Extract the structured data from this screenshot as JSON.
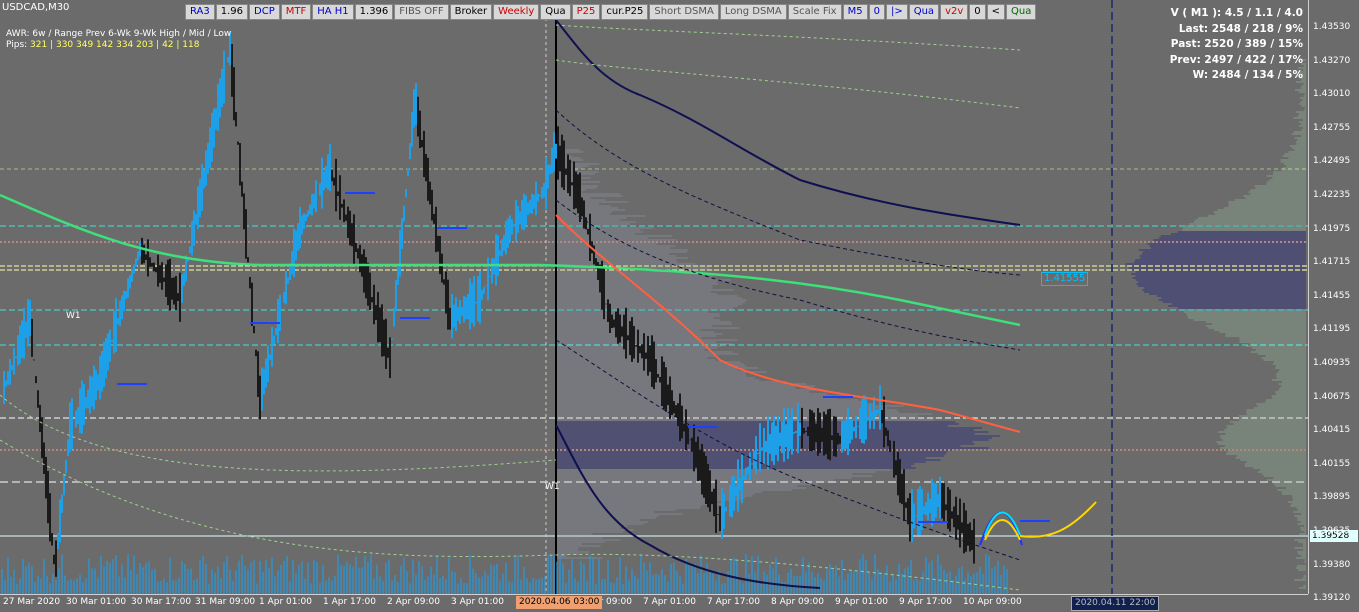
{
  "symbol_label": "USDCAD,M30",
  "toolbar": [
    {
      "label": "RA3",
      "color": "#0000cc"
    },
    {
      "label": "1.96",
      "color": "#000000"
    },
    {
      "label": "DCP",
      "color": "#0000cc"
    },
    {
      "label": "MTF",
      "color": "#cc0000"
    },
    {
      "label": "HA H1",
      "color": "#0000cc"
    },
    {
      "label": "1.396",
      "color": "#000000"
    },
    {
      "label": "FIBS OFF",
      "color": "#555555"
    },
    {
      "label": "Broker",
      "color": "#000000"
    },
    {
      "label": "Weekly",
      "color": "#cc0000"
    },
    {
      "label": "Qua",
      "color": "#000000"
    },
    {
      "label": "P25",
      "color": "#cc0000"
    },
    {
      "label": "cur.P25",
      "color": "#000000"
    },
    {
      "label": "Short DSMA",
      "color": "#555555"
    },
    {
      "label": "Long DSMA",
      "color": "#555555"
    },
    {
      "label": "Scale Fix",
      "color": "#555555"
    },
    {
      "label": "M5",
      "color": "#0000cc"
    },
    {
      "label": "0",
      "color": "#0000cc"
    },
    {
      "label": "|>",
      "color": "#0000cc"
    },
    {
      "label": "Qua",
      "color": "#0000cc"
    },
    {
      "label": "v2v",
      "color": "#cc0000"
    },
    {
      "label": "0",
      "color": "#000000"
    },
    {
      "label": "<",
      "color": "#000000"
    },
    {
      "label": "Qua",
      "color": "#006600"
    }
  ],
  "awr": {
    "line1": "AWR: 6w / Range    Prev      6-Wk       9-Wk       High / Mid / Low",
    "line2_label": "Pips:",
    "line2_values": "321 | 330     349      142       334          203  |  42  |  118"
  },
  "stats": {
    "v_line": "V ( M1 ): 4.5 / 1.1 / 4.0",
    "last": "Last: 2548 / 218 / 9%",
    "past": "Past: 2520 / 389 / 15%",
    "prev": "Prev: 2497 / 422 / 17%",
    "w": "W: 2484 / 134 / 5%"
  },
  "level_label": "1.41555",
  "w1_labels": [
    "W1",
    "W1"
  ],
  "price_axis": [
    "1.43530",
    "1.43270",
    "1.43010",
    "1.42755",
    "1.42495",
    "1.42235",
    "1.41975",
    "1.41715",
    "1.41455",
    "1.41195",
    "1.40935",
    "1.40675",
    "1.40415",
    "1.40155",
    "1.39895",
    "1.39635",
    "1.39380",
    "1.39120"
  ],
  "current_price": "1.39528",
  "time_axis": [
    "27 Mar 2020",
    "30 Mar 01:00",
    "30 Mar 17:00",
    "31 Mar 09:00",
    "1 Apr 01:00",
    "1 Apr 17:00",
    "2 Apr 09:00",
    "3 Apr 01:00",
    "",
    "6 Apr 09:00",
    "7 Apr 01:00",
    "7 Apr 17:00",
    "8 Apr 09:00",
    "9 Apr 01:00",
    "9 Apr 17:00",
    "10 Apr 09:00"
  ],
  "time_highlight_a": "2020.04.06 03:00",
  "time_highlight_b": "2020.04.11 22:00",
  "colors": {
    "bull": "#1ea0e8",
    "bear": "#1a1a1a",
    "ma_green": "#3de07a",
    "ma_red": "#ff6040",
    "envelope": "#101050",
    "profile": "#2a2a80",
    "cyan": "#40e0e0",
    "yellow": "#ffd700"
  }
}
